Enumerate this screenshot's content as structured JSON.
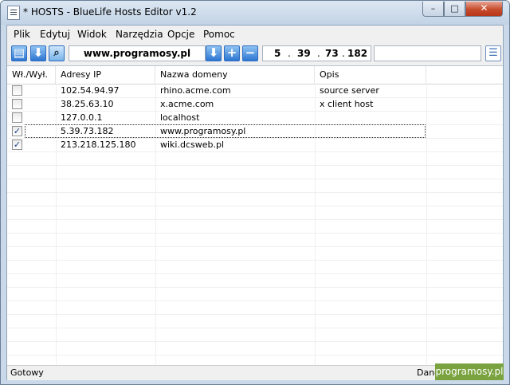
{
  "window": {
    "title": "* HOSTS - BlueLife Hosts Editor v1.2",
    "controls": {
      "minimize": "–",
      "maximize": "□",
      "close": "✕"
    }
  },
  "menu": [
    "Plik",
    "Edytuj",
    "Widok",
    "Narzędzia",
    "Opcje",
    "Pomoc"
  ],
  "toolbar": {
    "url_value": "www.programosy.pl",
    "ip_octets": [
      "5",
      "39",
      "73",
      "182"
    ],
    "ip_separator": ".",
    "description_value": "",
    "icons": [
      "save-icon",
      "import-icon",
      "search-icon",
      "move-down-icon",
      "add-icon",
      "remove-icon",
      "view-list-icon"
    ],
    "icon_glyphs": {
      "save": "▤",
      "import": "⬇",
      "search": "⌕",
      "move_down": "⬇",
      "add": "+",
      "remove": "−",
      "view": "☰"
    }
  },
  "table": {
    "columns": [
      "Wł./Wył.",
      "Adresy IP",
      "Nazwa domeny",
      "Opis"
    ],
    "rows": [
      {
        "checked": false,
        "ip": "102.54.94.97",
        "domain": "rhino.acme.com",
        "desc": "source server"
      },
      {
        "checked": false,
        "ip": "38.25.63.10",
        "domain": "x.acme.com",
        "desc": "x client host"
      },
      {
        "checked": false,
        "ip": "127.0.0.1",
        "domain": "localhost",
        "desc": ""
      },
      {
        "checked": true,
        "ip": "5.39.73.182",
        "domain": "www.programosy.pl",
        "desc": ""
      },
      {
        "checked": true,
        "ip": "213.218.125.180",
        "domain": "wiki.dcsweb.pl",
        "desc": ""
      }
    ],
    "check_mark": "✓"
  },
  "status": {
    "left": "Gotowy",
    "right": "Dane"
  },
  "watermark": "programosy.pl"
}
